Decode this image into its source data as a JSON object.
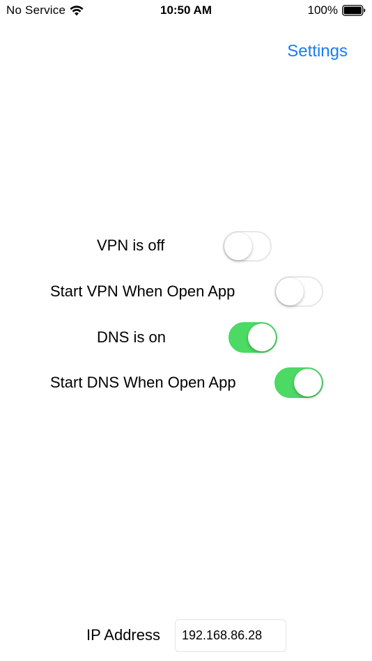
{
  "status_bar": {
    "carrier": "No Service",
    "time": "10:50 AM",
    "battery": "100%"
  },
  "nav": {
    "settings_label": "Settings",
    "accent_color": "#1a7cf5"
  },
  "toggles": [
    {
      "label": "VPN is off",
      "on": false
    },
    {
      "label": "Start VPN When Open App",
      "on": false
    },
    {
      "label": "DNS is on",
      "on": true
    },
    {
      "label": "Start DNS When Open App",
      "on": true
    }
  ],
  "switch_on_color": "#4cd964",
  "ip": {
    "label": "IP Address",
    "value": "192.168.86.28"
  }
}
